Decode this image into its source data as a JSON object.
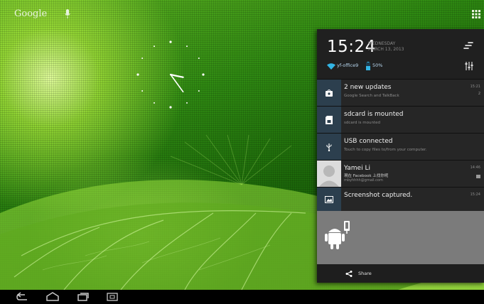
{
  "launcher": {
    "search_label": "Google",
    "mic_icon": "mic-icon",
    "apps_icon": "all-apps-grid-icon"
  },
  "clock_widget": {
    "hour": 15,
    "minute": 24
  },
  "notification_panel": {
    "time": "15:24",
    "day": "WEDNESDAY",
    "date": "MARCH 13, 2013",
    "network": "yf-office9",
    "battery": "50%",
    "notifications": [
      {
        "icon": "store-icon",
        "title": "2 new updates",
        "subtitle": "Google Search and TalkBack",
        "time": "15:21",
        "badge": "2"
      },
      {
        "icon": "sdcard-icon",
        "title": "sdcard is mounted",
        "subtitle": "sdcard is mounted"
      },
      {
        "icon": "usb-icon",
        "title": "USB connected",
        "subtitle": "Touch to copy files to/from your computer."
      },
      {
        "icon": "avatar",
        "title": "Yamei Li",
        "subtitle": "現在 Facebook 上找你呢",
        "subtitle2": "mbyhhhh@gmail.com",
        "time": "14:46"
      },
      {
        "icon": "screenshot-icon",
        "title": "Screenshot captured.",
        "time": "15:24"
      }
    ],
    "share_label": "Share"
  },
  "colors": {
    "accent": "#33b5e5",
    "panel_bg": "#1c1c1c",
    "icon_bg": "#2c3f4e"
  }
}
